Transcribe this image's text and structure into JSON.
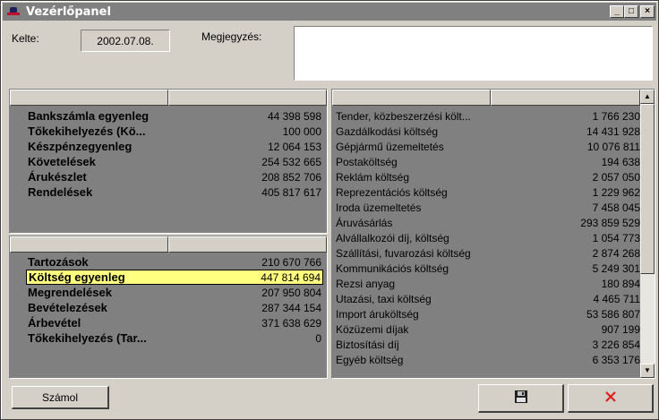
{
  "window": {
    "title": "Vezérlőpanel",
    "controls": {
      "minimize": "_",
      "maximize": "□",
      "close": "×"
    }
  },
  "form": {
    "date_label": "Kelte:",
    "date_value": "2002.07.08.",
    "note_label": "Megjegyzés:",
    "note_value": ""
  },
  "assets_panel": {
    "rows": [
      {
        "name": "Bankszámla egyenleg",
        "value": "44 398 598"
      },
      {
        "name": "Tőkekihelyezés (Kö...",
        "value": "100 000"
      },
      {
        "name": "Készpénzegyenleg",
        "value": "12 064 153"
      },
      {
        "name": "Követelések",
        "value": "254 532 665"
      },
      {
        "name": "Árukészlet",
        "value": "208 852 706"
      },
      {
        "name": "Rendelések",
        "value": "405 817 617"
      }
    ]
  },
  "liabilities_panel": {
    "rows": [
      {
        "name": "Tartozások",
        "value": "210 670 766"
      },
      {
        "name": "Költség egyenleg",
        "value": "447 814 694",
        "selected": true
      },
      {
        "name": "Megrendelések",
        "value": "207 950 804"
      },
      {
        "name": "Bevételezések",
        "value": "287 344 154"
      },
      {
        "name": "Árbevétel",
        "value": "371 638 629"
      },
      {
        "name": "Tőkekihelyezés (Tar...",
        "value": "0"
      }
    ]
  },
  "costs_panel": {
    "rows": [
      {
        "name": "Tender, közbeszerzési költ...",
        "value": "1 766 230"
      },
      {
        "name": "Gazdálkodási költség",
        "value": "14 431 928"
      },
      {
        "name": "Gépjármű üzemeltetés",
        "value": "10 076 811"
      },
      {
        "name": "Postaköltség",
        "value": "194 638"
      },
      {
        "name": "Reklám költség",
        "value": "2 057 050"
      },
      {
        "name": "Reprezentációs költség",
        "value": "1 229 962"
      },
      {
        "name": "Iroda üzemeltetés",
        "value": "7 458 045"
      },
      {
        "name": "Áruvásárlás",
        "value": "293 859 529"
      },
      {
        "name": "Alvállalkozói díj, költség",
        "value": "1 054 773"
      },
      {
        "name": "Szállítási, fuvarozási költség",
        "value": "2 874 268"
      },
      {
        "name": "Kommunikációs költség",
        "value": "5 249 301"
      },
      {
        "name": "Rezsi anyag",
        "value": "180 894"
      },
      {
        "name": "Utazási, taxi költség",
        "value": "4 465 711"
      },
      {
        "name": "Import áruköltség",
        "value": "53 586 807"
      },
      {
        "name": "Közüzemi díjak",
        "value": "907 199"
      },
      {
        "name": "Biztosítási díj",
        "value": "3 226 854"
      },
      {
        "name": "Egyéb költség",
        "value": "6 353 176"
      }
    ]
  },
  "buttons": {
    "calculate_label": "Számol",
    "save_icon": "floppy-disk-icon",
    "cancel_icon": "red-x-icon"
  }
}
